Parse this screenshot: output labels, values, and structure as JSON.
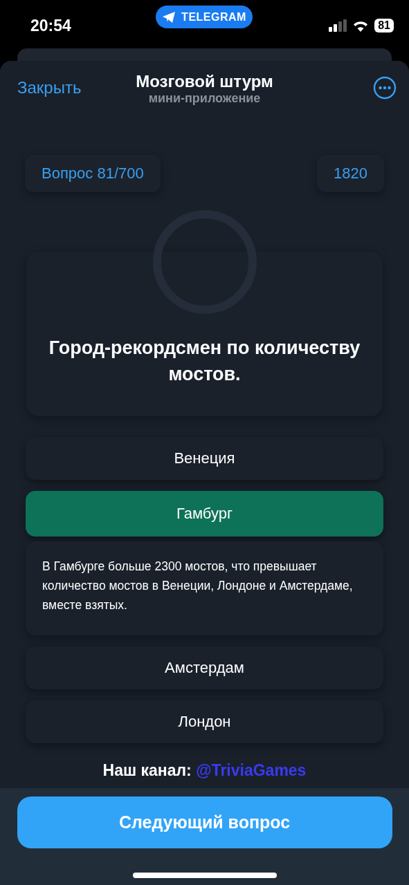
{
  "status_bar": {
    "time": "20:54",
    "app_pill": "TELEGRAM",
    "battery": "81"
  },
  "header": {
    "close": "Закрыть",
    "title": "Мозговой штурм",
    "subtitle": "мини-приложение"
  },
  "stats": {
    "question_counter": "Вопрос 81/700",
    "score": "1820"
  },
  "question": "Город-рекордсмен по количеству мостов.",
  "options": [
    {
      "label": "Венеция",
      "correct": false
    },
    {
      "label": "Гамбург",
      "correct": true,
      "explanation": "В Гамбурге больше 2300 мостов, что превышает количество мостов в Венеции, Лондоне и Амстердаме, вместе взятых."
    },
    {
      "label": "Амстердам",
      "correct": false
    },
    {
      "label": "Лондон",
      "correct": false
    }
  ],
  "channel": {
    "label": "Наш канал:",
    "link": "@TriviaGames"
  },
  "next_button": "Следующий вопрос"
}
